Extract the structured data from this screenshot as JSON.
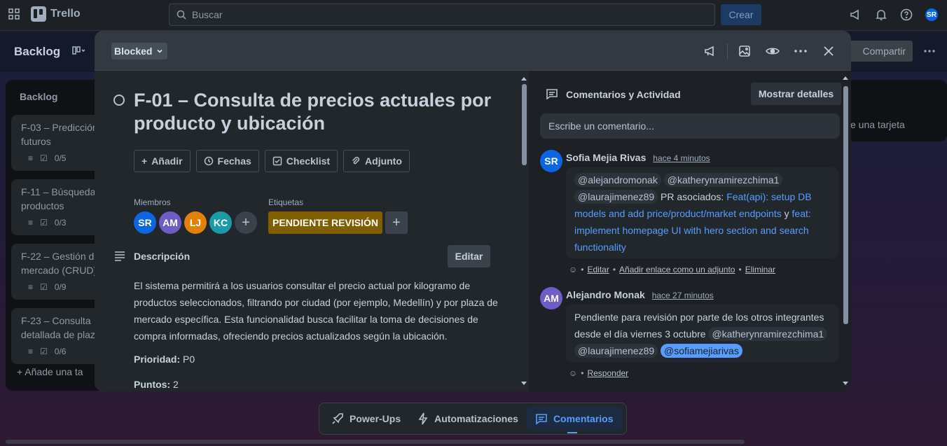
{
  "topbar": {
    "app_name": "Trello",
    "search_placeholder": "Buscar",
    "create_label": "Crear",
    "user_initials": "SR"
  },
  "board": {
    "title": "Backlog",
    "share_label": "Compartir",
    "list": {
      "title": "Backlog",
      "cards": [
        {
          "text": "F-03 – Predicción futuros",
          "checklist": "0/5"
        },
        {
          "text": "F-11 – Búsqueda productos",
          "checklist": "0/3"
        },
        {
          "text": "F-22 – Gestión de mercado (CRUD)",
          "checklist": "0/9"
        },
        {
          "text": "F-23 – Consulta detallada de plaz",
          "checklist": "0/6"
        }
      ],
      "add_card": "+  Añade una ta"
    },
    "list2_partial": "e una tarjeta"
  },
  "dock": {
    "powerups": "Power-Ups",
    "automations": "Automatizaciones",
    "comments": "Comentarios"
  },
  "card": {
    "status": "Blocked",
    "title": "F-01 – Consulta de precios actuales por producto y ubicación",
    "actions": {
      "add": "Añadir",
      "dates": "Fechas",
      "checklist": "Checklist",
      "attachment": "Adjunto"
    },
    "members_label": "Miembros",
    "members": [
      {
        "initials": "SR",
        "color": "#0c66e4"
      },
      {
        "initials": "AM",
        "color": "#6e5dc6"
      },
      {
        "initials": "LJ",
        "color": "#e2810a"
      },
      {
        "initials": "KC",
        "color": "#1d9aaa"
      }
    ],
    "labels_label": "Etiquetas",
    "label": "PENDIENTE REVISIÓN",
    "label_color": "#7f5f01",
    "description_title": "Descripción",
    "edit_label": "Editar",
    "description": "El sistema permitirá a los usuarios consultar el precio actual por kilogramo de productos seleccionados, filtrando por ciudad (por ejemplo, Medellín) y por plaza de mercado específica. Esta funcionalidad busca facilitar la toma de decisiones de compra informadas, ofreciendo precios actualizados según la ubicación.",
    "priority_key": "Prioridad:",
    "priority_value": "P0",
    "points_key": "Puntos:",
    "points_value": "2"
  },
  "activity": {
    "title": "Comentarios y Actividad",
    "show_details": "Mostrar detalles",
    "comment_placeholder": "Escribe un comentario...",
    "comments": [
      {
        "initials": "SR",
        "color": "#0c66e4",
        "author": "Sofia Mejia Rivas",
        "time": "hace 4 minutos",
        "mentions": [
          "@alejandromonak",
          "@katherynramirezchima1",
          "@laurajimenez89"
        ],
        "text1": "PR asociados:",
        "link1": "Feat(api): setup DB models and add price/product/market endpoints",
        "joiner": "y",
        "link2": "feat: implement homepage UI with hero section and search functionality",
        "foot": {
          "edit": "Editar",
          "attach": "Añadir enlace como un adjunto",
          "delete": "Eliminar"
        }
      },
      {
        "initials": "AM",
        "color": "#6e5dc6",
        "author": "Alejandro Monak",
        "time": "hace 27 minutos",
        "text": "Pendiente para revisión por parte de los otros integrantes desde el día viernes 3 octubre",
        "mentions": [
          "@katherynramirezchima1",
          "@laurajimenez89",
          "@sofiamejiarivas"
        ],
        "foot": {
          "reply": "Responder"
        }
      }
    ]
  }
}
